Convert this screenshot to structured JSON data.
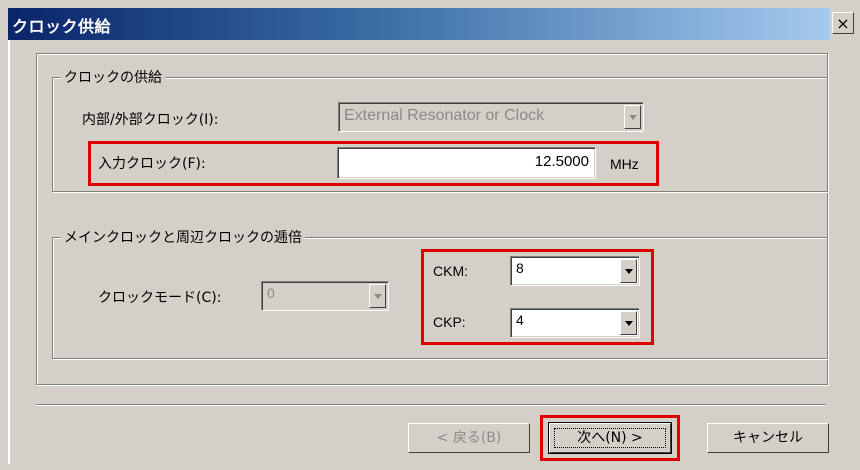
{
  "window": {
    "title": "クロック供給",
    "close_glyph": "×"
  },
  "clock_supply_group": {
    "title": "クロックの供給",
    "internal_external": {
      "label": "内部/外部クロック(I):",
      "value": "External Resonator or Clock"
    },
    "input_clock": {
      "label": "入力クロック(F):",
      "value": "12.5000",
      "unit": "MHz"
    }
  },
  "multiplier_group": {
    "title": "メインクロックと周辺クロックの逓倍",
    "clock_mode": {
      "label": "クロックモード(C):",
      "value": "0"
    },
    "ckm": {
      "label": "CKM:",
      "value": "8"
    },
    "ckp": {
      "label": "CKP:",
      "value": "4"
    }
  },
  "buttons": {
    "back": "< 戻る(B)",
    "next": "次へ(N) >",
    "cancel": "キャンセル"
  },
  "highlight_color": "#e00000"
}
